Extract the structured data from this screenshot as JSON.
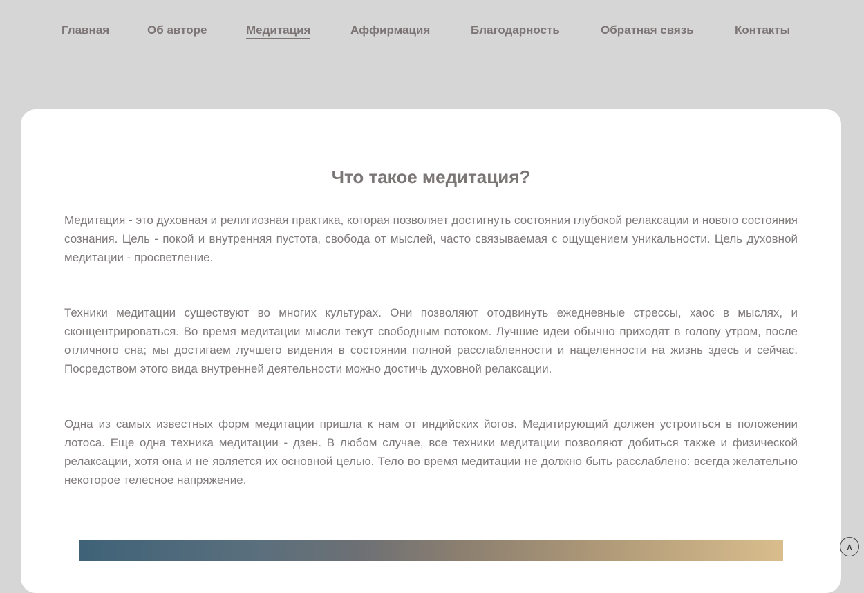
{
  "nav": [
    {
      "label": "Главная",
      "active": false
    },
    {
      "label": "Об авторе",
      "active": false
    },
    {
      "label": "Медитация",
      "active": true
    },
    {
      "label": "Аффирмация",
      "active": false
    },
    {
      "label": "Благодарность",
      "active": false
    },
    {
      "label": "Обратная связь",
      "active": false
    },
    {
      "label": "Контакты",
      "active": false
    }
  ],
  "main": {
    "title": "Что такое медитация?",
    "paragraphs": [
      "Медитация - это духовная и религиозная практика, которая позволяет достигнуть состояния глубокой релаксации и нового состояния сознания. Цель - покой и внутренняя пустота, свобода от мыслей, часто связываемая с ощущением уникальности. Цель духовной медитации - просветление.",
      "Техники медитации существуют во многих культурах. Они позволяют отодвинуть ежедневные стрессы, хаос в мыслях, и сконцентрироваться. Во время медитации мысли текут свободным потоком. Лучшие идеи обычно приходят в голову утром, после отличного сна; мы достигаем лучшего видения в состоянии полной расслабленности и нацеленности на жизнь здесь и сейчас. Посредством этого вида внутренней деятельности можно достичь духовной релаксации.",
      "Одна из самых известных форм медитации пришла к нам от индийских йогов. Медитирующий должен устроиться в положении лотоса. Еще одна техника медитации - дзен. В любом случае, все техники медитации позволяют добиться также и физической релаксации, хотя она и не является их основной целью. Тело во время медитации не должно быть расслаблено: всегда желательно некоторое телесное напряжение."
    ]
  },
  "scroll_top_icon": "chevron-up-circle-icon"
}
